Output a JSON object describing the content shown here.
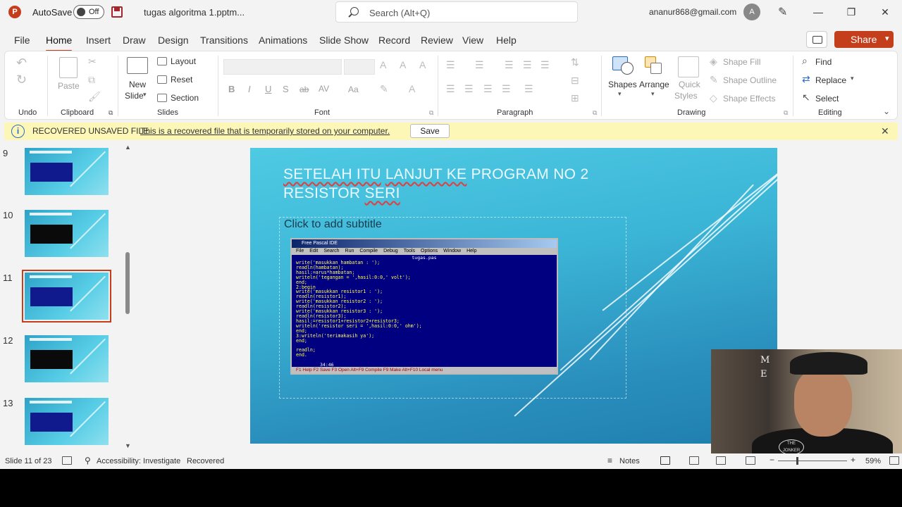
{
  "titlebar": {
    "app_logo": "P",
    "autosave_label": "AutoSave",
    "autosave_state": "Off",
    "doc_title": "tugas algoritma 1.pptm...",
    "search_placeholder": "Search (Alt+Q)",
    "account_email": "ananur868@gmail.com",
    "avatar_initial": "A",
    "minimize": "—",
    "restore": "❐",
    "close": "✕",
    "pen_icon": "✎"
  },
  "menu": {
    "tabs": [
      "File",
      "Home",
      "Insert",
      "Draw",
      "Design",
      "Transitions",
      "Animations",
      "Slide Show",
      "Record",
      "Review",
      "View",
      "Help"
    ],
    "active_tab": "Home",
    "share_label": "Share",
    "share_arrow": "▾"
  },
  "ribbon": {
    "groups": {
      "undo": "Undo",
      "clipboard": "Clipboard",
      "slides": "Slides",
      "font": "Font",
      "paragraph": "Paragraph",
      "drawing": "Drawing",
      "editing": "Editing"
    },
    "paste": "Paste",
    "new_slide": "New",
    "new_slide_2": "Slide",
    "layout": "Layout",
    "reset": "Reset",
    "section": "Section",
    "shapes": "Shapes",
    "arrange": "Arrange",
    "quick_styles": "Quick",
    "quick_styles_2": "Styles",
    "shape_fill": "Shape Fill",
    "shape_outline": "Shape Outline",
    "shape_effects": "Shape Effects",
    "find": "Find",
    "replace": "Replace",
    "select": "Select",
    "font_buttons": [
      "B",
      "I",
      "U",
      "S",
      "ab",
      "AV",
      "Aa"
    ]
  },
  "infobar": {
    "title": "RECOVERED UNSAVED FILE",
    "message": "This is a recovered file that is temporarily stored on your computer.",
    "save_label": "Save",
    "close": "✕"
  },
  "thumbnails": {
    "slides": [
      {
        "num": "9",
        "screen_color": "#101a8c",
        "selected": false
      },
      {
        "num": "10",
        "screen_color": "#0a0a0a",
        "selected": false
      },
      {
        "num": "11",
        "screen_color": "#101a8c",
        "selected": true
      },
      {
        "num": "12",
        "screen_color": "#0a0a0a",
        "selected": false
      },
      {
        "num": "13",
        "screen_color": "#101a8c",
        "selected": false
      }
    ]
  },
  "slide": {
    "title_line1_a": "SETELAH ITU",
    "title_line1_b": "LANJUT KE",
    "title_line1_c": " PROGRAM NO 2",
    "title_line2_a": "RESISTOR ",
    "title_line2_b": "SERI",
    "subtitle_placeholder": "Click to add subtitle",
    "ide": {
      "window_title": "Free Pascal IDE",
      "menu": [
        "File",
        "Edit",
        "Search",
        "Run",
        "Compile",
        "Debug",
        "Tools",
        "Options",
        "Window",
        "Help"
      ],
      "file_name": "tugas.pas",
      "code_lines": [
        "write('masukkan hambatan : ');",
        "readln(hambatan);",
        "hasil:=arus*hambatan;",
        "writeln('tegangan = ',hasil:0:0,' volt');",
        "end;",
        "2:begin",
        "write('masukkan resistor1 : ');",
        "readln(resistor1);",
        "write('masukkan resistor2 : ');",
        "readln(resistor2);",
        "write('masukkan resistor3 : ');",
        "readln(resistor3);",
        "hasil:=resistor1+resistor2+resistor3;",
        "writeln('resistor seri = ',hasil:0:0,' ohm');",
        "end;",
        "3:writeln('terimakasih ya');",
        "end;",
        "",
        "readln;",
        "end."
      ],
      "cursor_pos": "34:46",
      "status": "F1 Help  F2 Save  F3 Open  Alt+F9 Compile  F9 Make  Alt+F10 Local menu"
    }
  },
  "webcam": {
    "wall_letters": "M\nE",
    "shirt_logo": "THE\nJONKER"
  },
  "statusbar": {
    "slide_info": "Slide 11 of 23",
    "accessibility": "Accessibility: Investigate",
    "recovered": "Recovered",
    "notes": "Notes",
    "zoom_minus": "−",
    "zoom_plus": "+",
    "zoom_level": "59%"
  }
}
